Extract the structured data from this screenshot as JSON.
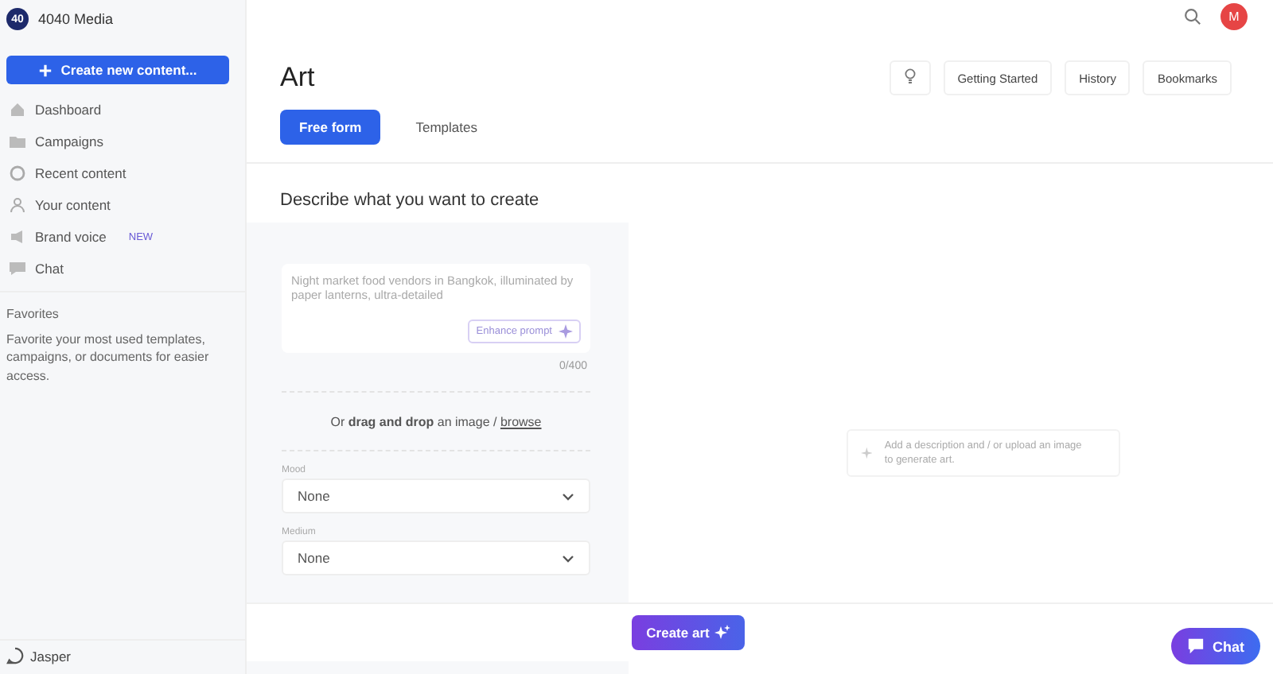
{
  "workspace": {
    "badge": "40",
    "name": "4040 Media"
  },
  "create_button": "Create new content...",
  "sidebar": {
    "items": [
      {
        "label": "Dashboard"
      },
      {
        "label": "Campaigns"
      },
      {
        "label": "Recent content"
      },
      {
        "label": "Your content"
      },
      {
        "label": "Brand voice",
        "badge": "NEW"
      },
      {
        "label": "Chat"
      }
    ],
    "favorites": {
      "title": "Favorites",
      "text": "Favorite your most used templates, campaigns, or documents for easier access."
    },
    "footer": "Jasper"
  },
  "user": {
    "initial": "M"
  },
  "page": {
    "title": "Art",
    "actions": [
      "Getting Started",
      "History",
      "Bookmarks"
    ],
    "tabs": [
      {
        "label": "Free form",
        "selected": true
      },
      {
        "label": "Templates",
        "selected": false
      }
    ],
    "heading": "Describe what you want to create"
  },
  "form": {
    "prompt": {
      "placeholder": "Night market food vendors in Bangkok, illuminated by paper lanterns, ultra-detailed",
      "enhance": "Enhance prompt",
      "counter": "0/400"
    },
    "upload": {
      "prefix": "Or ",
      "bold": "drag and drop",
      "middle": " an image / ",
      "link": "browse"
    },
    "selects": [
      {
        "label": "Mood",
        "value": "None"
      },
      {
        "label": "Medium",
        "value": "None"
      }
    ],
    "submit": "Create art"
  },
  "preview": {
    "hint": "Add a description and / or upload an image to generate art."
  },
  "chat_button": "Chat"
}
